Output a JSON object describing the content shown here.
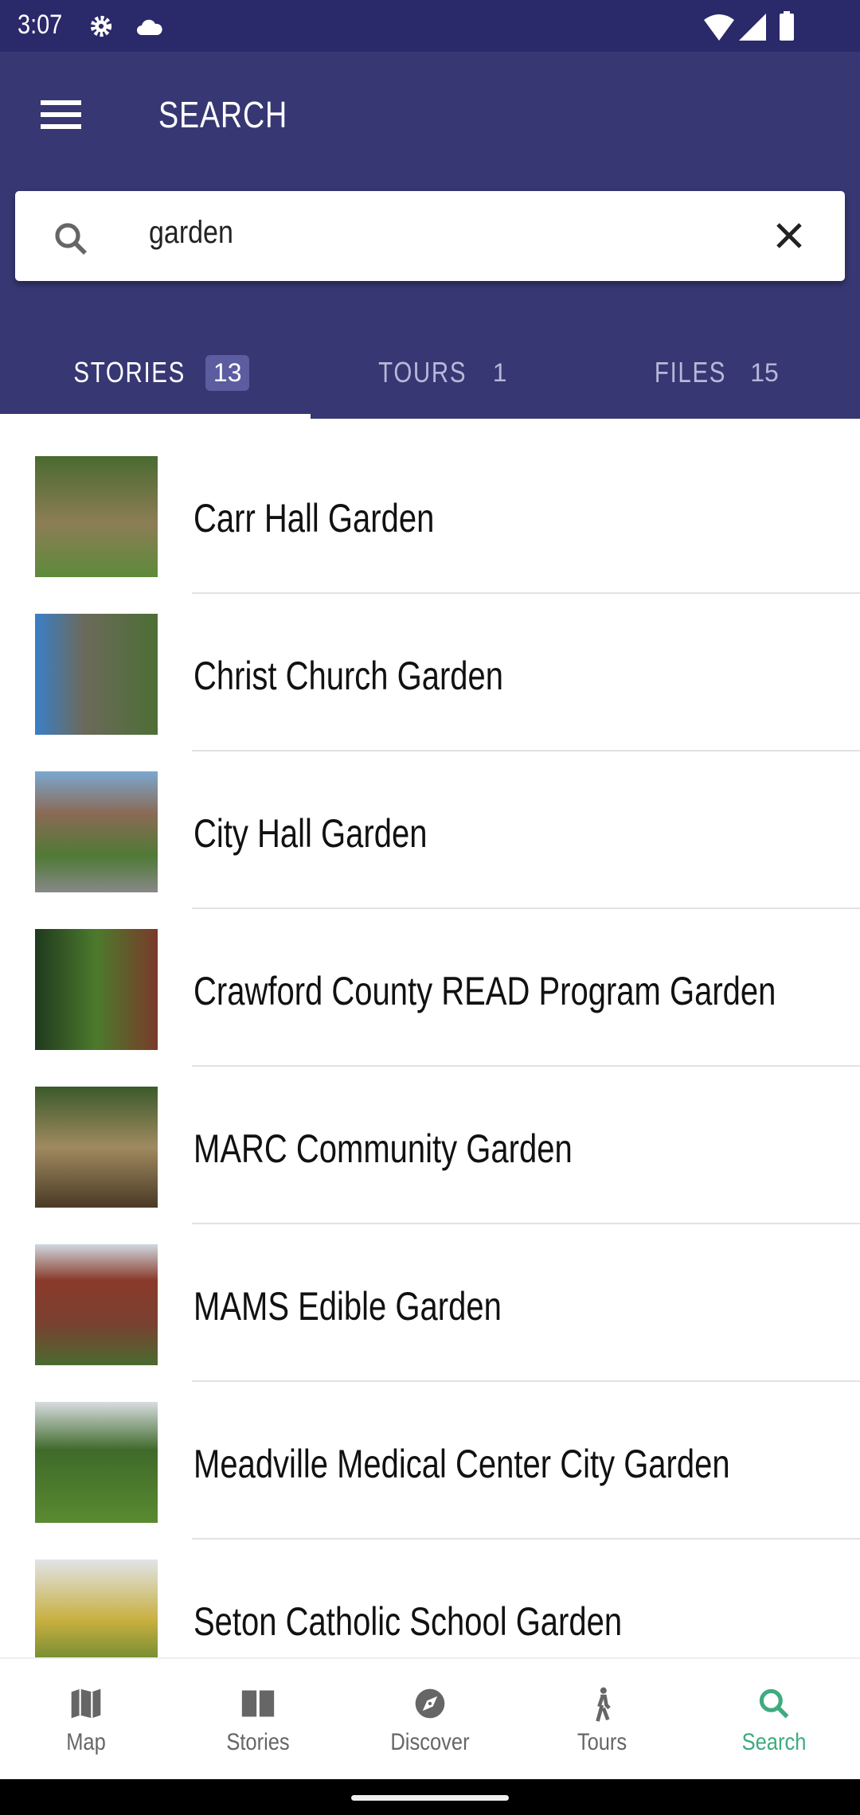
{
  "status_bar": {
    "time": "3:07"
  },
  "app_bar": {
    "title": "SEARCH"
  },
  "search": {
    "query": "garden"
  },
  "tabs": [
    {
      "label": "STORIES",
      "count": "13",
      "active": true
    },
    {
      "label": "TOURS",
      "count": "1"
    },
    {
      "label": "FILES",
      "count": "15"
    }
  ],
  "results": [
    "Carr Hall Garden",
    "Christ Church Garden",
    "City Hall Garden",
    "Crawford County READ Program Garden",
    "MARC Community Garden",
    "MAMS Edible Garden",
    "Meadville Medical Center City Garden",
    "Seton Catholic School Garden"
  ],
  "bottom_nav": [
    {
      "label": "Map",
      "icon": "map-icon"
    },
    {
      "label": "Stories",
      "icon": "book-icon"
    },
    {
      "label": "Discover",
      "icon": "compass-icon"
    },
    {
      "label": "Tours",
      "icon": "walk-icon"
    },
    {
      "label": "Search",
      "icon": "search-icon",
      "active": true
    }
  ],
  "colors": {
    "header": "#373774",
    "status": "#2a296a",
    "accent": "#3fab80"
  }
}
